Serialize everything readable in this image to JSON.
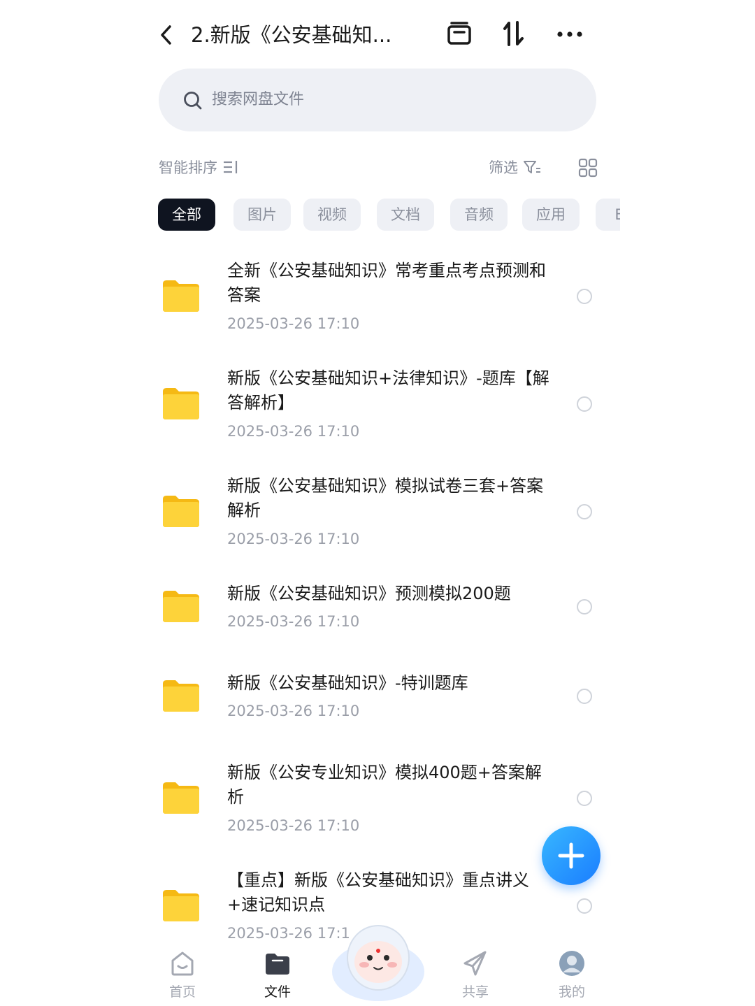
{
  "header": {
    "title": "2.新版《公安基础知...",
    "back_icon": "chevron-left-icon",
    "icons": [
      "archive-icon",
      "sort-arrows-icon",
      "more-icon"
    ]
  },
  "search": {
    "placeholder": "搜索网盘文件"
  },
  "sort": {
    "label": "智能排序",
    "filter_label": "筛选"
  },
  "tabs": [
    {
      "label": "全部",
      "active": true
    },
    {
      "label": "图片",
      "active": false
    },
    {
      "label": "视频",
      "active": false
    },
    {
      "label": "文档",
      "active": false
    },
    {
      "label": "音频",
      "active": false
    },
    {
      "label": "应用",
      "active": false
    },
    {
      "label": "BT",
      "active": false
    }
  ],
  "files": [
    {
      "name": "全新《公安基础知识》常考重点考点预测和答案",
      "date": "2025-03-26  17:10"
    },
    {
      "name": "新版《公安基础知识+法律知识》-题库【解答解析】",
      "date": "2025-03-26  17:10"
    },
    {
      "name": "新版《公安基础知识》模拟试卷三套+答案解析",
      "date": "2025-03-26  17:10"
    },
    {
      "name": "新版《公安基础知识》预测模拟200题",
      "date": "2025-03-26  17:10"
    },
    {
      "name": "新版《公安基础知识》-特训题库",
      "date": "2025-03-26  17:10"
    },
    {
      "name": "新版《公安专业知识》模拟400题+答案解析",
      "date": "2025-03-26  17:10"
    },
    {
      "name": "【重点】新版《公安基础知识》重点讲义+速记知识点",
      "date": "2025-03-26  17:1"
    }
  ],
  "bottom_nav": [
    {
      "label": "首页",
      "icon": "home-icon",
      "active": false
    },
    {
      "label": "文件",
      "icon": "folder-icon",
      "active": true
    },
    {
      "label": "共享",
      "icon": "share-icon",
      "active": false
    },
    {
      "label": "我的",
      "icon": "avatar-icon",
      "active": false
    }
  ],
  "colors": {
    "accent": "#1a7dff",
    "folder": "#fcc419",
    "active_tab": "#0f1420"
  }
}
